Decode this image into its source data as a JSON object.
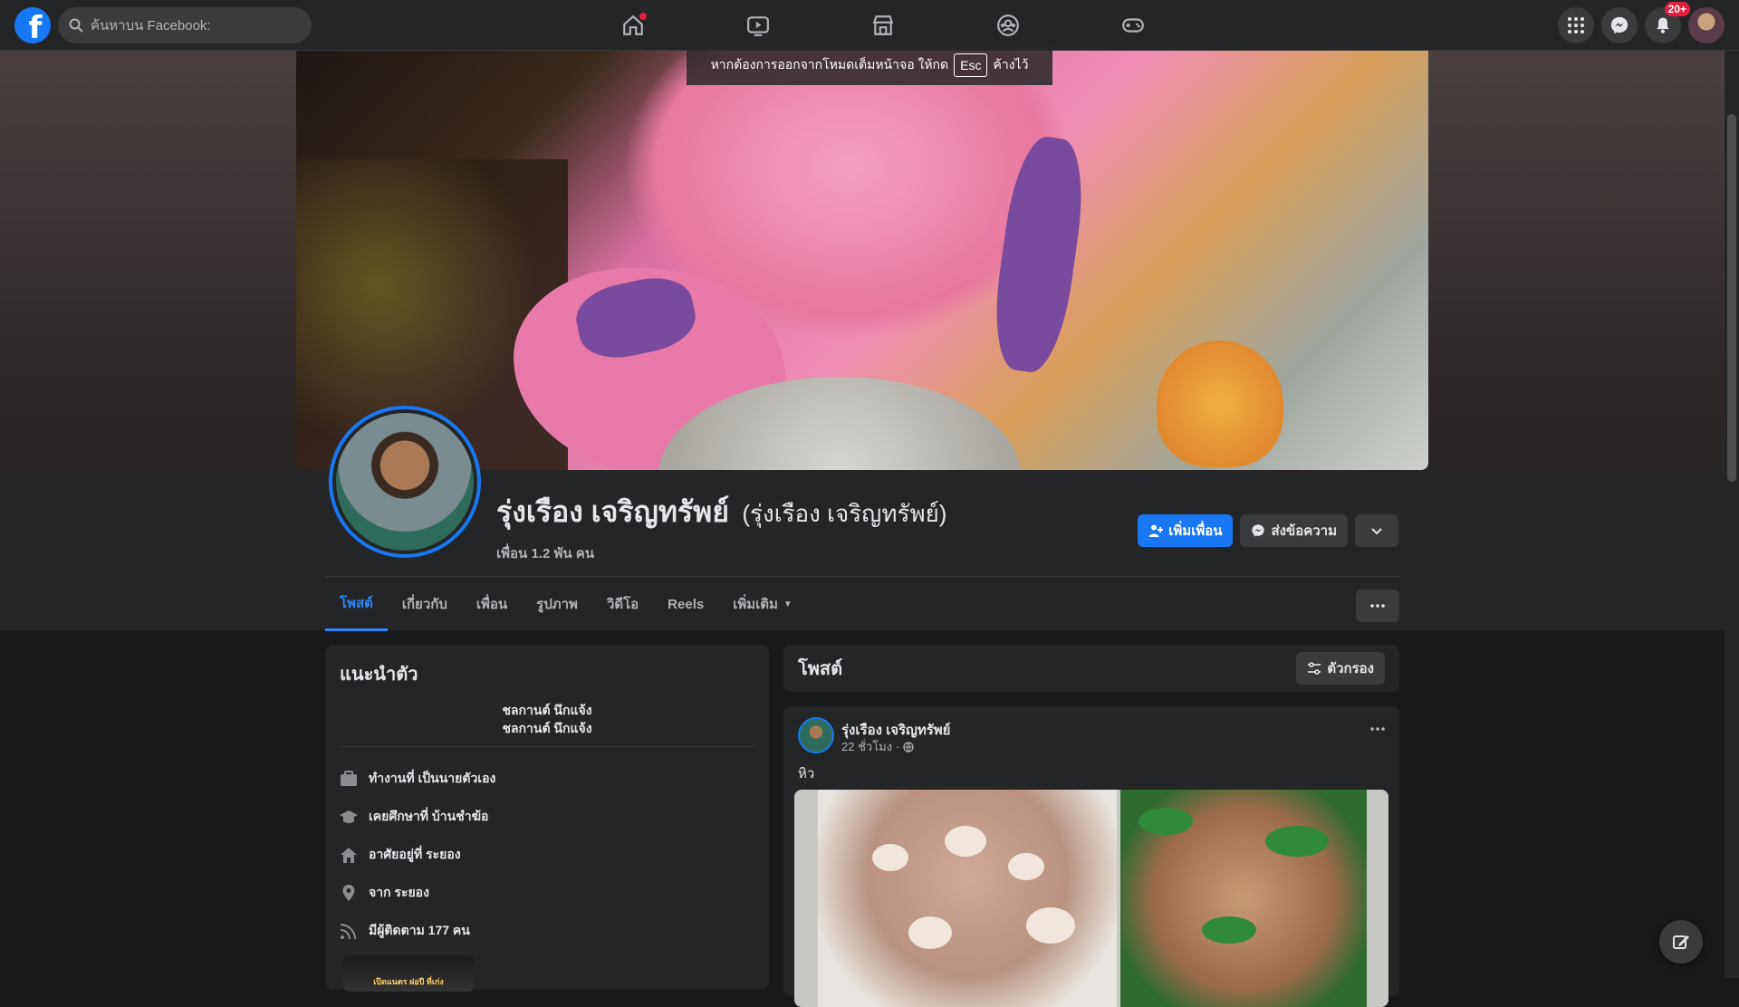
{
  "topbar": {
    "logo": "f",
    "search_placeholder": "ค้นหาบน Facebook:",
    "nav_icons": [
      "home-icon",
      "video-icon",
      "marketplace-icon",
      "groups-icon",
      "gaming-icon"
    ],
    "notifications_badge": "20+"
  },
  "fullscreen_toast": {
    "before": "หากต้องการออกจากโหมดเต็มหน้าจอ ให้กด",
    "key": "Esc",
    "after": "ค้างไว้"
  },
  "profile": {
    "name": "รุ่งเรือง เจริญทรัพย์",
    "alt_name": "(รุ่งเรือง เจริญทรัพย์)",
    "friends": "เพื่อน 1.2 พัน คน",
    "add_friend_label": "เพิ่มเพื่อน",
    "message_label": "ส่งข้อความ"
  },
  "tabs": [
    {
      "label": "โพสต์",
      "active": true
    },
    {
      "label": "เกี่ยวกับ"
    },
    {
      "label": "เพื่อน"
    },
    {
      "label": "รูปภาพ"
    },
    {
      "label": "วิดีโอ"
    },
    {
      "label": "Reels"
    },
    {
      "label": "เพิ่มเติม"
    }
  ],
  "intro": {
    "title": "แนะนำตัว",
    "bio_line1": "ชลกานต์ นึกแจ้ง",
    "bio_line2": "ชลกานต์ นึกแจ้ง",
    "items": [
      {
        "icon": "briefcase-icon",
        "text": "ทำงานที่ เป็นนายตัวเอง"
      },
      {
        "icon": "graduation-cap-icon",
        "text": "เคยศึกษาที่ บ้านชำฆ้อ"
      },
      {
        "icon": "home-icon",
        "text": "อาศัยอยู่ที่ ระยอง"
      },
      {
        "icon": "location-pin-icon",
        "text": "จาก ระยอง"
      },
      {
        "icon": "rss-icon",
        "text": "มีผู้ติดตาม 177 คน"
      }
    ],
    "promo_text": "เปิดแนตร ฝอปี ที่เก่ง"
  },
  "posts": {
    "title": "โพสต์",
    "filter_label": "ตัวกรอง",
    "items": [
      {
        "author": "รุ่งเรือง เจริญทรัพย์",
        "time": "22 ชั่วโมง ·",
        "text": "หิว"
      }
    ]
  },
  "colors": {
    "accent": "#1877f2",
    "active_tab": "#2d88ff",
    "background": "#18191a",
    "card": "#242526"
  }
}
